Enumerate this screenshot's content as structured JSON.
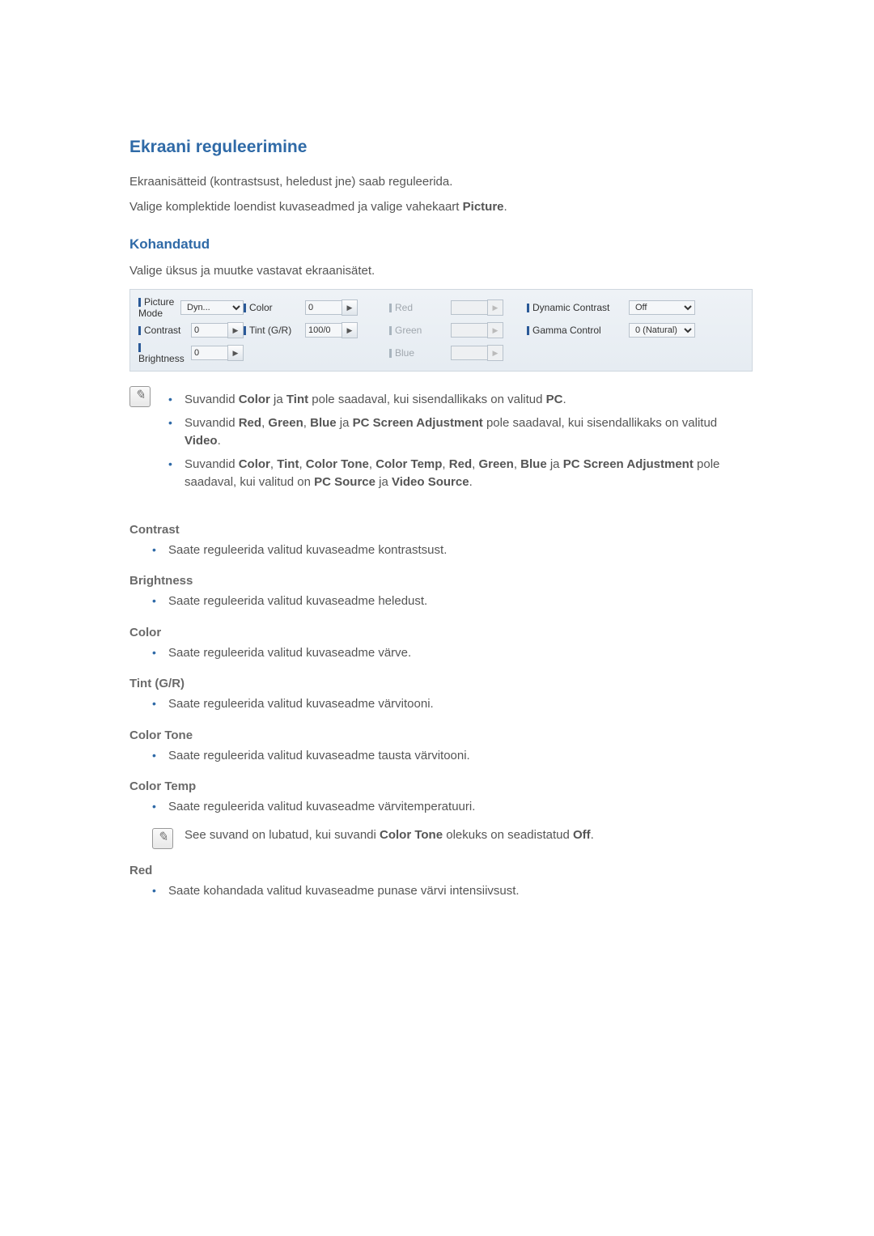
{
  "title": "Ekraani reguleerimine",
  "intro1": "Ekraanisätteid (kontrastsust, heledust jne) saab reguleerida.",
  "intro2_a": "Valige komplektide loendist kuvaseadmed ja valige vahekaart ",
  "intro2_b": "Picture",
  "intro2_c": ".",
  "custom_heading": "Kohandatud",
  "custom_desc": "Valige üksus ja muutke vastavat ekraanisätet.",
  "panel": {
    "picture_mode": {
      "label": "Picture Mode",
      "value": "Dyn..."
    },
    "color": {
      "label": "Color",
      "value": "0"
    },
    "red": {
      "label": "Red",
      "value": ""
    },
    "dynamic_contrast": {
      "label": "Dynamic Contrast",
      "value": "Off"
    },
    "contrast": {
      "label": "Contrast",
      "value": "0"
    },
    "tint": {
      "label": "Tint (G/R)",
      "value": "100/0"
    },
    "green": {
      "label": "Green",
      "value": ""
    },
    "gamma": {
      "label": "Gamma Control",
      "value": "0 (Natural)"
    },
    "brightness": {
      "label": "Brightness",
      "value": "0"
    },
    "blue": {
      "label": "Blue",
      "value": ""
    }
  },
  "notes": {
    "n1_a": "Suvandid ",
    "n1_b": "Color",
    "n1_c": " ja ",
    "n1_d": "Tint",
    "n1_e": " pole saadaval, kui sisendallikaks on valitud ",
    "n1_f": "PC",
    "n1_g": ".",
    "n2_a": "Suvandid ",
    "n2_b": "Red",
    "n2_c": ", ",
    "n2_d": "Green",
    "n2_e": ", ",
    "n2_f": "Blue",
    "n2_g": " ja ",
    "n2_h": "PC Screen Adjustment",
    "n2_i": " pole saadaval, kui sisendallikaks on valitud ",
    "n2_j": "Video",
    "n2_k": ".",
    "n3_a": "Suvandid ",
    "n3_b": "Color",
    "n3_c": ", ",
    "n3_d": "Tint",
    "n3_e": ", ",
    "n3_f": "Color Tone",
    "n3_g": ", ",
    "n3_h": "Color Temp",
    "n3_i": ", ",
    "n3_j": "Red",
    "n3_k": ", ",
    "n3_l": "Green",
    "n3_m": ", ",
    "n3_n": "Blue",
    "n3_o": " ja ",
    "n3_p": "PC Screen Adjustment",
    "n3_q": " pole saadaval, kui valitud on ",
    "n3_r": "PC Source",
    "n3_s": " ja ",
    "n3_t": "Video Source",
    "n3_u": "."
  },
  "defs": {
    "contrast": {
      "title": "Contrast",
      "text": "Saate reguleerida valitud kuvaseadme kontrastsust."
    },
    "brightness": {
      "title": "Brightness",
      "text": "Saate reguleerida valitud kuvaseadme heledust."
    },
    "color": {
      "title": "Color",
      "text": "Saate reguleerida valitud kuvaseadme värve."
    },
    "tint": {
      "title": "Tint (G/R)",
      "text": "Saate reguleerida valitud kuvaseadme värvitooni."
    },
    "colortone": {
      "title": "Color Tone",
      "text": "Saate reguleerida valitud kuvaseadme tausta värvitooni."
    },
    "colortemp": {
      "title": "Color Temp",
      "text": "Saate reguleerida valitud kuvaseadme värvitemperatuuri.",
      "note_a": "See suvand on lubatud, kui suvandi ",
      "note_b": "Color Tone",
      "note_c": " olekuks on seadistatud ",
      "note_d": "Off",
      "note_e": "."
    },
    "red": {
      "title": "Red",
      "text": "Saate kohandada valitud kuvaseadme punase värvi intensiivsust."
    }
  }
}
